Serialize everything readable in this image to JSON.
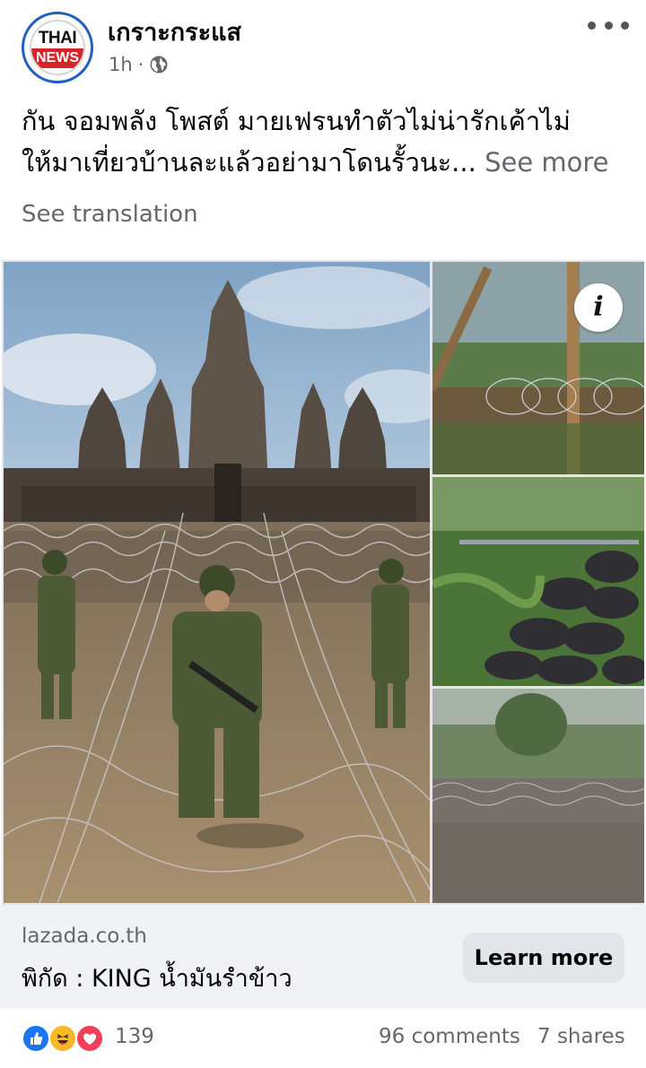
{
  "post": {
    "page_name": "เกราะกระแส",
    "avatar": {
      "line1": "THAI",
      "line2": "NEWS"
    },
    "time": "1h",
    "separator": "·",
    "audience_icon": "globe-icon",
    "more_icon": "more-options-icon",
    "caption_line1": "กัน จอมพลัง โพสต์ มายเฟรนทำตัวไม่น่ารักเค้าไม่",
    "caption_line2": "ให้มาเที่ยวบ้านละแล้วอย่ามาโดนรั้วนะ...",
    "see_more": "See more",
    "see_translation": "See translation"
  },
  "media": {
    "info_icon": "i",
    "photos": [
      "soldiers-at-temple-photo",
      "razor-wire-forest-photo",
      "sandbag-bunker-photo",
      "barbed-wire-field-photo"
    ]
  },
  "ad": {
    "domain": "lazada.co.th",
    "title": "พิกัด : KING น้ำมันรำข้าว",
    "cta_label": "Learn more"
  },
  "engagement": {
    "reaction_icons": [
      "like-icon",
      "haha-icon",
      "love-icon"
    ],
    "reaction_count": "139",
    "comments": "96 comments",
    "shares": "7 shares"
  },
  "colors": {
    "accent_blue": "#1877f2",
    "secondary_text": "#65676b",
    "ad_background": "#f0f2f5",
    "button_background": "#e2e5e9"
  }
}
